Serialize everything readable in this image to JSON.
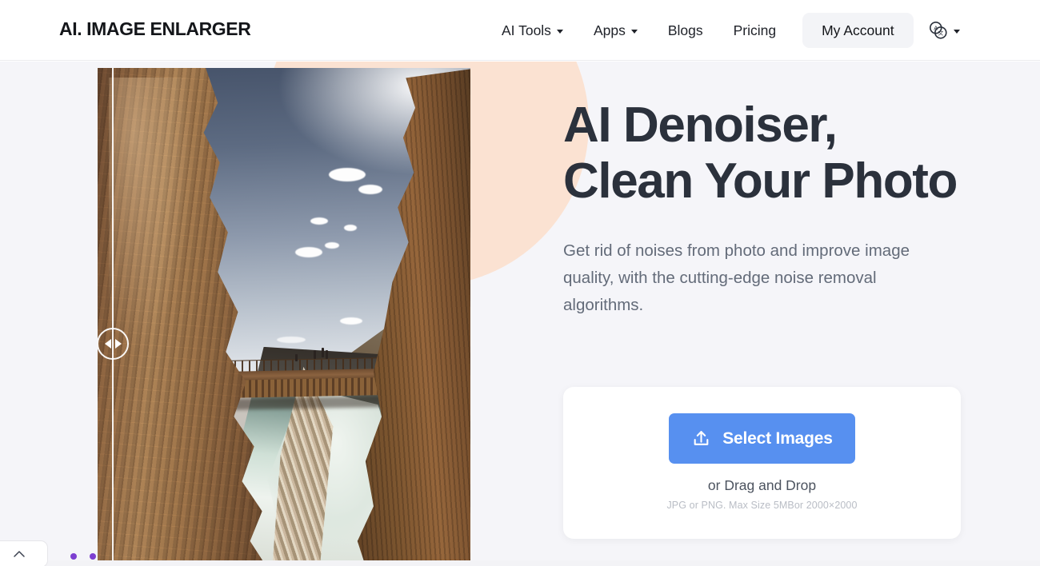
{
  "header": {
    "brand": "AI. IMAGE ENLARGER",
    "nav": [
      {
        "label": "AI Tools",
        "has_caret": true,
        "icon": "chevron-down-icon"
      },
      {
        "label": "Apps",
        "has_caret": true,
        "icon": "chevron-down-icon"
      },
      {
        "label": "Blogs",
        "has_caret": false,
        "icon": ""
      },
      {
        "label": "Pricing",
        "has_caret": false,
        "icon": ""
      }
    ],
    "account_button": "My Account",
    "language_icon": "language-translate-icon",
    "language_caret_icon": "chevron-down-icon"
  },
  "hero": {
    "headline": "AI Denoiser, Clean Your Photo",
    "subtitle": "Get rid of noises from photo and improve image quality, with the cutting-edge noise removal algorithms.",
    "upload": {
      "button_label": "Select Images",
      "button_icon": "upload-icon",
      "drag_text": "or Drag and Drop",
      "fine_print": "JPG or PNG. Max Size 5MBor 2000×2000"
    },
    "comparison_slider": {
      "handle_icon_left": "arrow-left-icon",
      "handle_icon_right": "arrow-right-icon",
      "photo_alt": "canyon-cliff-walkway-photo"
    }
  },
  "widgets": {
    "scroll_top_icon": "chevron-up-icon",
    "carousel_dots": 2
  },
  "colors": {
    "accent_blue": "#5790f0",
    "peach_circle": "#fbe2d2",
    "hero_background": "#f5f5f9",
    "headline_text": "#2b313c",
    "body_text": "#636b79",
    "dot_purple": "#7d3fd1",
    "account_button_bg": "#f3f4f7"
  }
}
